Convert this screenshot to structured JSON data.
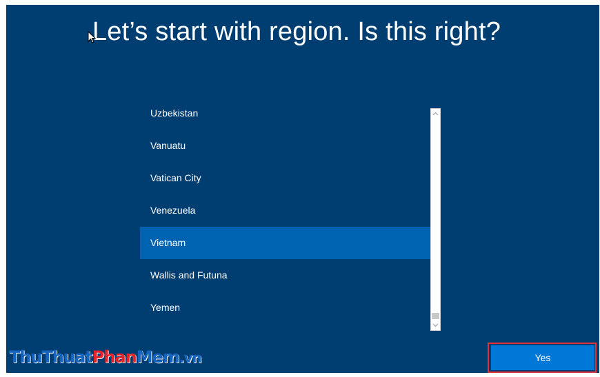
{
  "page": {
    "title": "Let’s start with region. Is this right?"
  },
  "region_list": {
    "items": [
      {
        "label": "Uzbekistan",
        "selected": false
      },
      {
        "label": "Vanuatu",
        "selected": false
      },
      {
        "label": "Vatican City",
        "selected": false
      },
      {
        "label": "Venezuela",
        "selected": false
      },
      {
        "label": "Vietnam",
        "selected": true
      },
      {
        "label": "Wallis and Futuna",
        "selected": false
      },
      {
        "label": "Yemen",
        "selected": false
      }
    ],
    "scroll_position": 0.97
  },
  "actions": {
    "yes_label": "Yes"
  },
  "watermark": {
    "part1": "ThuThuat",
    "part2": "Phan",
    "part3": "Mem",
    "part4": ".vn"
  },
  "colors": {
    "background": "#003e72",
    "selected_row": "#0063b1",
    "button": "#0078d7",
    "highlight_outline": "#e0303a"
  },
  "icons": {
    "cursor": "mouse-pointer-icon",
    "scroll_up": "chevron-up-icon",
    "scroll_down": "chevron-down-icon"
  }
}
